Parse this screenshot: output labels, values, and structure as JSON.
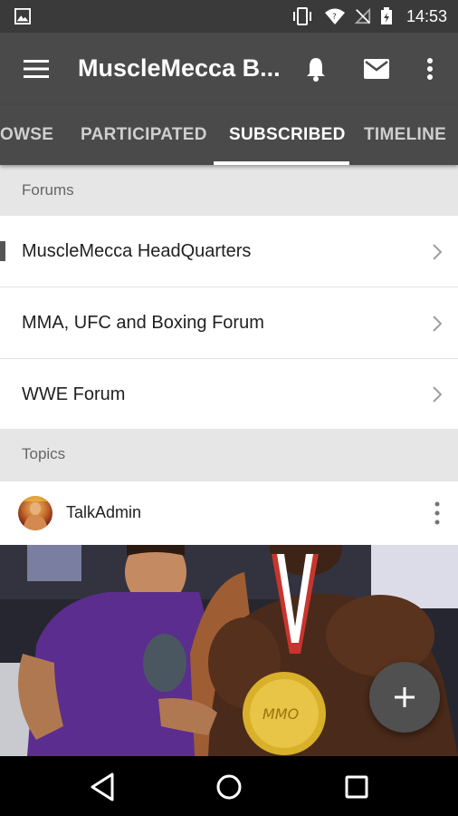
{
  "status_bar": {
    "time": "14:53"
  },
  "app_bar": {
    "title": "MuscleMecca B..."
  },
  "tabs": [
    {
      "label": "OWSE"
    },
    {
      "label": "PARTICIPATED"
    },
    {
      "label": "SUBSCRIBED",
      "active": true
    },
    {
      "label": "TIMELINE"
    }
  ],
  "forums_section": {
    "header": "Forums",
    "items": [
      {
        "label": "MuscleMecca HeadQuarters"
      },
      {
        "label": "MMA, UFC and Boxing Forum"
      },
      {
        "label": "WWE Forum"
      }
    ]
  },
  "topics_section": {
    "header": "Topics",
    "topic": {
      "author": "TalkAdmin"
    }
  },
  "fab": {
    "icon": "plus-icon"
  },
  "colors": {
    "app_bar": "#4a4a4a",
    "status_bar": "#3a3a3a",
    "section_header": "#e6e6e6"
  }
}
